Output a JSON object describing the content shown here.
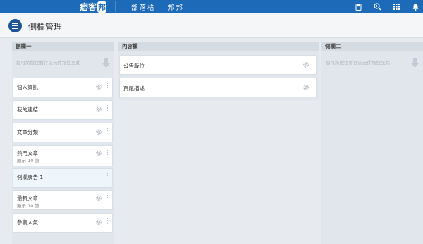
{
  "topbar": {
    "logo_text": "痞客",
    "logo_box": "邦",
    "nav": [
      {
        "label": "部落格"
      },
      {
        "label": "邦邦"
      }
    ],
    "icons": [
      "bookmark-icon",
      "search-icon",
      "apps-grid-icon",
      "bell-icon"
    ],
    "bg_color": "#1c6ab8"
  },
  "header": {
    "title": "側欄管理"
  },
  "columns": {
    "left": {
      "title": "側欄一",
      "drop_hint": "您可將版位暫存區元件拖拉至此",
      "widgets": [
        {
          "title": "個人資訊",
          "sub": ""
        },
        {
          "title": "我的連結",
          "sub": ""
        },
        {
          "title": "文章分類",
          "sub": ""
        },
        {
          "title": "熱門文章",
          "sub": "顯示 10 筆"
        },
        {
          "title": "側欄廣告 1",
          "sub": ""
        },
        {
          "title": "最新文章",
          "sub": "顯示 10 筆"
        },
        {
          "title": "參觀人氣",
          "sub": ""
        }
      ]
    },
    "mid": {
      "title": "內容欄",
      "widgets": [
        {
          "title": "公告版位"
        },
        {
          "title": "頁尾描述"
        }
      ]
    },
    "right": {
      "title": "側欄二",
      "drop_hint": "您可將版位暫存區元件拖拉至此"
    }
  }
}
